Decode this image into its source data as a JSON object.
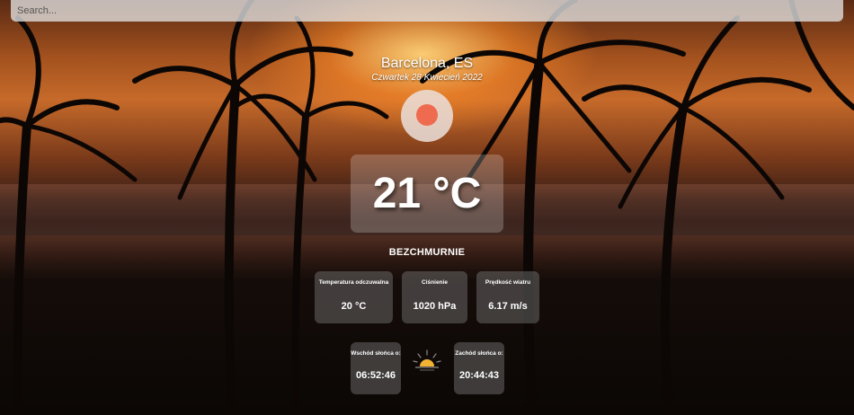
{
  "search": {
    "placeholder": "Search..."
  },
  "location": {
    "city": "Barcelona, ES",
    "date": "Czwartek 28 Kwiecień 2022"
  },
  "weather": {
    "icon": "clear-sky-sun-icon",
    "temperature": "21 °C",
    "condition": "BEZCHMURNIE"
  },
  "details": [
    {
      "label": "Temperatura odczuwalna",
      "value": "20 °C"
    },
    {
      "label": "Ciśnienie",
      "value": "1020 hPa"
    },
    {
      "label": "Prędkość wiatru",
      "value": "6.17 m/s"
    }
  ],
  "sun": {
    "sunrise_label": "Wschód słońca o:",
    "sunrise_time": "06:52:46",
    "sunset_label": "Zachód słońca o:",
    "sunset_time": "20:44:43",
    "icon": "sunrise-icon"
  },
  "colors": {
    "sun_dot": "#ef6b50",
    "sunrise_icon": "#f2b233"
  }
}
